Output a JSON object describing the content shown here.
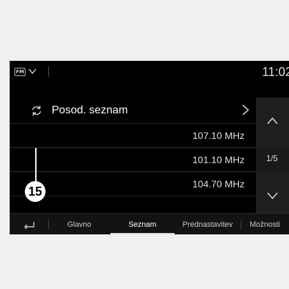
{
  "status_bar": {
    "band_badge": "FM",
    "clock": "11:02",
    "band_chevron_icon": "chevron-down-icon"
  },
  "list": {
    "header_icon": "refresh-icon",
    "header_label": "Posod. seznam",
    "header_chevron_icon": "chevron-right-icon",
    "stations": [
      {
        "frequency": "107.10 MHz"
      },
      {
        "frequency": "101.10 MHz"
      },
      {
        "frequency": "104.70 MHz"
      }
    ]
  },
  "scroll": {
    "page_indicator": "1/5",
    "up_icon": "chevron-up-icon",
    "down_icon": "chevron-down-icon"
  },
  "callout": {
    "number": "15"
  },
  "tabs": {
    "back_icon": "back-arrow-icon",
    "items": [
      {
        "label": "Glavno"
      },
      {
        "label": "Seznam"
      },
      {
        "label": "Prednastavitev"
      },
      {
        "label": "Možnosti"
      }
    ],
    "active_index": 1
  },
  "colors": {
    "screen_bg": "#000000",
    "page_bg": "#f0f0f0",
    "text": "#ffffff"
  }
}
